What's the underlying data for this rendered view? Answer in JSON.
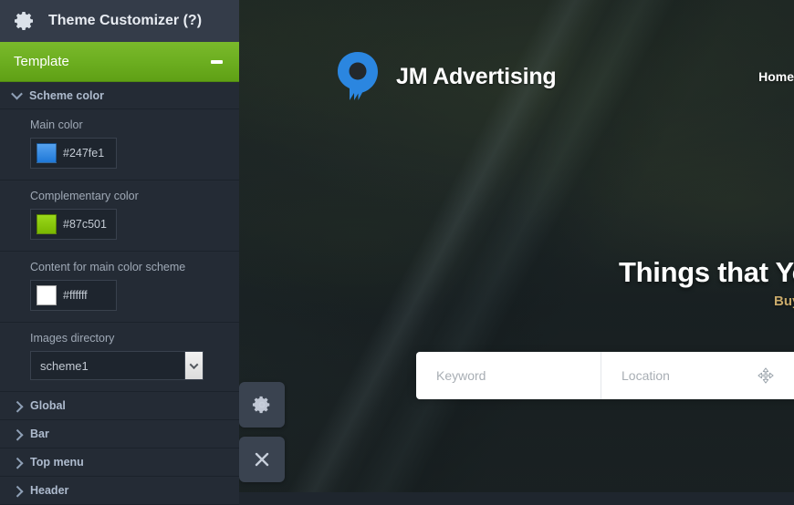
{
  "panel": {
    "header": {
      "title": "Theme Customizer (?)",
      "icon": "gear-icon"
    },
    "section": {
      "label": "Template",
      "toggle_icon": "minus-icon"
    },
    "scheme": {
      "label": "Scheme color",
      "chevron": "chevron-down-icon",
      "fields": [
        {
          "label": "Main color",
          "value": "#247fe1",
          "swatch": "#247fe1"
        },
        {
          "label": "Complementary color",
          "value": "#87c501",
          "swatch": "#87c501"
        },
        {
          "label": "Content for main color scheme",
          "value": "#ffffff",
          "swatch": "#ffffff"
        }
      ],
      "directory": {
        "label": "Images directory",
        "value": "scheme1",
        "options": [
          "scheme1"
        ]
      }
    },
    "collapsed_sections": [
      {
        "label": "Global",
        "chevron": "chevron-right-icon"
      },
      {
        "label": "Bar",
        "chevron": "chevron-right-icon"
      },
      {
        "label": "Top menu",
        "chevron": "chevron-right-icon"
      },
      {
        "label": "Header",
        "chevron": "chevron-right-icon"
      }
    ]
  },
  "float_buttons": [
    {
      "name": "settings",
      "icon": "gear-icon"
    },
    {
      "name": "close",
      "icon": "close-icon"
    }
  ],
  "site": {
    "brand": {
      "name": "JM Advertising",
      "logo_icon": "location-pin-logo-icon",
      "logo_color": "#2b86e0"
    },
    "nav": [
      {
        "label": "Home"
      }
    ],
    "hero": {
      "title": "Things that You",
      "subtitle": "Buy",
      "search": {
        "keyword_placeholder": "Keyword",
        "location_placeholder": "Location",
        "geo_icon": "crosshair-locate-icon"
      }
    }
  },
  "colors": {
    "accent_green": "#6cae20",
    "panel_bg": "#242b35",
    "panel_header_bg": "#343c49",
    "brand_blue": "#2b86e0"
  }
}
